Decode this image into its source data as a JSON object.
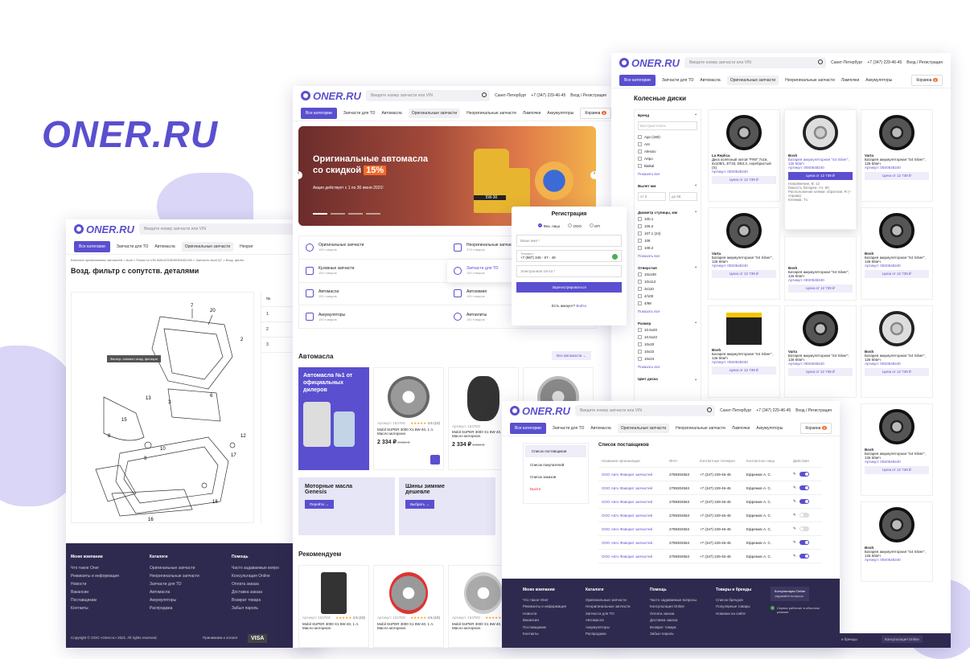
{
  "brand": "ONER.RU",
  "common": {
    "logo": "ONER.RU",
    "search_placeholder": "Введите номер запчасти или VIN",
    "city": "Санкт-Петербург",
    "phone": "+7 (347) 229-46-45",
    "login": "Вход / Регистрация",
    "all_categories": "Все категории",
    "nav": [
      "Запчасти для ТО",
      "Автомасла",
      "Оригинальные запчасти",
      "Неоригинальные запчасти",
      "Лампочки",
      "Аккумуляторы"
    ],
    "cart": "Корзина",
    "cart_count": "2"
  },
  "left_window": {
    "nav": [
      "Запчасти для ТО",
      "Автомасла",
      "Оригинальные запчасти",
      "Неориг"
    ],
    "breadcrumb": "Каталоги оригинальных запчастей  >  Audi  >  Поиск по VIN WAUZZZ4M0HD04D149  >  Запчасти Audi Q7  >  Возд. фильт",
    "title": "Возд. фильтр с сопутств. деталями",
    "tooltip": "Фильтр. элемент возд. фильтра",
    "callouts": [
      "7",
      "20",
      "2",
      "3",
      "6",
      "13",
      "15",
      "8",
      "9",
      "10",
      "12",
      "17",
      "18",
      "16"
    ],
    "table_header": "№",
    "table_rows": [
      "1",
      "2",
      "3"
    ],
    "footer": {
      "col1_title": "Меню компании",
      "col1": [
        "Что такое Oner",
        "Реквизиты и информация",
        "Новости",
        "Вакансии",
        "Поставщикам",
        "Контакты"
      ],
      "col2_title": "Каталоги",
      "col2": [
        "Оригинальные запчасти",
        "Неоригинальные запчасти",
        "Запчасти для ТО",
        "Автомасла",
        "Аккумуляторы",
        "Распродажа"
      ],
      "col3_title": "Помощь",
      "col3": [
        "Часто задаваемые вопро",
        "Консультация Online",
        "Оплата заказа",
        "Доставка заказа",
        "Возврат товара",
        "Забыл пароль"
      ],
      "copyright": "Copyright © ООО «Oner.ru» 2021. All rights reserved.",
      "payment": "Принимаем к оплате",
      "visa": "VISA"
    }
  },
  "center_window": {
    "banner_title_1": "Оригинальные автомасла",
    "banner_title_2": "со скидкой",
    "banner_discount": "15%",
    "banner_sub": "Акция действует с 1 по 30 июня 2021!",
    "oil_label": "5W-30",
    "categories": [
      {
        "name": "Оригинальные запчасти",
        "count": "150 товаров"
      },
      {
        "name": "Неоригинальные запчасти",
        "count": "376 товаров"
      },
      {
        "name": "Кузовные запчасти",
        "count": "150 товаров"
      },
      {
        "name": "Запчасти для ТО",
        "count": "150 товаров"
      },
      {
        "name": "Автомасла",
        "count": "150 товаров"
      },
      {
        "name": "Автохимия",
        "count": "150 товаров"
      },
      {
        "name": "Аккумуляторы",
        "count": "150 товаров"
      },
      {
        "name": "Автоилиты",
        "count": "150 товаров"
      }
    ],
    "section_oils": "Автомасла",
    "all_oils": "Все автомасла",
    "promo_title": "Автомасла №1 от официальных дилеров",
    "products": [
      {
        "article": "Артикул: 1537EE",
        "rating": "4.5 (10)",
        "name": "Mobil SUPER 3000 X1 5W-40, 1 л. Масло моторное.",
        "price": "2 334 ₽",
        "old": "3 856 ₽"
      },
      {
        "article": "Артикул: 1537EE",
        "rating": "",
        "name": "Mobil SUPER 3000 X1 5W-40, 1 л. Масло моторное.",
        "price": "2 334 ₽",
        "old": "3 856 ₽"
      }
    ],
    "promo2_title": "Моторные масла Genesis",
    "promo2_btn": "Перейти",
    "promo3_title": "Шины зимние дешевле",
    "promo3_btn": "Выбрать",
    "section_rec": "Рекомендуем",
    "rec": [
      {
        "article": "Артикул: 1537EE",
        "rating": "4.5 (10)",
        "name": "Mobil SUPER 3000 X1 5W-40, 1 л. Масло моторное."
      },
      {
        "article": "Артикул: 1537EE",
        "rating": "4.5 (10)",
        "name": "Mobil SUPER 3000 X1 5W-40, 1 л. Масло моторное."
      },
      {
        "article": "Артикул: 1537EE",
        "rating": "4.5 (10)",
        "name": "Mobil SUPER 3000 X1 5W-40, 1 л. Масло моторное."
      }
    ]
  },
  "register_modal": {
    "title": "Регистрация",
    "types": [
      "Физ. лицо",
      "ООО",
      "ИП"
    ],
    "name_placeholder": "Ваше имя *",
    "phone_label": "Телефон *",
    "phone_value": "+7 (987) 345 - 67 - 49",
    "email_placeholder": "Электронная почта *",
    "submit": "Зарегистрироваться",
    "have_account": "Есть аккаунт?",
    "login_link": "Войти"
  },
  "right_window": {
    "nav": [
      "Запчасти для ТО",
      "Автомасла",
      "Оригинальные запчасти",
      "Неоригинальные запчасти",
      "Лампочки",
      "Аккумуляторы"
    ],
    "title": "Колесные диски",
    "filters": {
      "brand_title": "Бренд",
      "brand_search": "Быстрый поиск",
      "brands": [
        "Ago (180)",
        "Ant",
        "Alessio",
        "Artpo",
        "Baikal"
      ],
      "show_all": "Показать все",
      "reach_title": "Вылет мм",
      "from": "от 0",
      "to": "до 68",
      "hub_title": "Диаметр ступицы, мм",
      "hubs": [
        "100.1",
        "106.2",
        "107.1 (24)",
        "108",
        "108.2"
      ],
      "holes_title": "Отверстия",
      "holes": [
        "10x108",
        "10x112",
        "3x110",
        "4/100",
        "4/98"
      ],
      "size_title": "Размер",
      "sizes": [
        "10.5x20",
        "10.5x22",
        "10x20",
        "10x22",
        "10x24"
      ],
      "color_title": "Цвет диска"
    },
    "products": [
      {
        "brand": "La Replica",
        "name": "Диск колёсный литой \"FR8\" 7x16, 5x108/1, ET33, D63.3, серебристый (S)",
        "article": "Артикул: 00S0548240",
        "price": "Цена от 12 739 ₽"
      },
      {
        "brand": "Bosh",
        "name": "Батарея аккумуляторная \"S4 Silver\", 12в 60а/ч",
        "article": "Артикул: 00S0548240",
        "price": "Цена от 12 739 ₽",
        "extra1": "Напряжение, В: 12",
        "extra2": "Емкость батареи, Ач: 60",
        "extra3": "Расположение клемм: обратная, R (+ справа)",
        "extra4": "Клемма: Т1"
      },
      {
        "brand": "Varta",
        "name": "Батарея аккумуляторная \"S4 Silver\", 12в 60а/ч",
        "article": "Артикул: 00S0548240",
        "price": "Цена от 12 739 ₽"
      },
      {
        "brand": "Varta",
        "name": "Батарея аккумуляторная \"S4 Silver\", 12в 60а/ч",
        "article": "Артикул: 00S0548240",
        "price": "Цена от 12 739 ₽"
      },
      {
        "brand": "Bosh",
        "name": "Батарея аккумуляторная \"S4 Silver\", 12в 60а/ч",
        "article": "Артикул: 00S0548240",
        "price": "Цена от 12 739 ₽"
      },
      {
        "brand": "Bosh",
        "name": "Батарея аккумуляторная \"S4 Silver\", 12в 60а/ч",
        "article": "Артикул: 00S0548240",
        "price": "Цена от 12 739 ₽"
      },
      {
        "brand": "Bosh",
        "name": "Батарея аккумуляторная \"S4 Silver\", 12в 60а/ч",
        "article": "Артикул: 00S0548240",
        "price": "Цена от 12 739 ₽"
      },
      {
        "brand": "Varta",
        "name": "Батарея аккумуляторная \"S4 Silver\", 12в 60а/ч",
        "article": "Артикул: 00S0548240",
        "price": "Цена от 12 739 ₽"
      },
      {
        "brand": "Bosh",
        "name": "Батарея аккумуляторная \"S4 Silver\", 12в 60а/ч",
        "article": "Артикул: 00S0548240",
        "price": "Цена от 12 739 ₽"
      }
    ],
    "extra_products": [
      {
        "brand": "Bosh",
        "name": "Батарея аккумуляторная \"S4 Silver\", 12в 60а/ч",
        "article": "Артикул: 00S0548240",
        "price": "Цена от 12 739 ₽"
      },
      {
        "brand": "Bosh",
        "name": "Батарея аккумуляторная \"S4 Silver\", 12в 60а/ч",
        "article": "Артикул: 00S0548240"
      }
    ],
    "footer_link": "Консультация Online",
    "footer_brands": "и бренды"
  },
  "suppliers_window": {
    "menu": [
      "Список поставщиков",
      "Список покупателей",
      "Список заказов",
      "Выйти"
    ],
    "title": "Список поставщиков",
    "columns": [
      "Название организации",
      "ИНН",
      "Контактные телефон",
      "Контактное лицо",
      "Действия"
    ],
    "rows": [
      {
        "org": "ООО Авто Фаворит запчастей",
        "inn": "2789304563",
        "phone": "+7 (347) 229-46-45",
        "person": "Ефремов А. С.",
        "on": true
      },
      {
        "org": "ООО Авто Фаворит запчастей",
        "inn": "2789304563",
        "phone": "+7 (347) 229-46-45",
        "person": "Ефремов А. С.",
        "on": true
      },
      {
        "org": "ООО Авто Фаворит запчастей",
        "inn": "2789304563",
        "phone": "+7 (347) 229-46-45",
        "person": "Ефремов А. С.",
        "on": true
      },
      {
        "org": "ООО Авто Фаворит запчастей",
        "inn": "2789304563",
        "phone": "+7 (347) 229-46-45",
        "person": "Ефремов А. С.",
        "on": false
      },
      {
        "org": "ООО Авто Фаворит запчастей",
        "inn": "2789304563",
        "phone": "+7 (347) 229-46-45",
        "person": "Ефремов А. С.",
        "on": false
      },
      {
        "org": "ООО Авто Фаворит запчастей",
        "inn": "2789304563",
        "phone": "+7 (347) 229-46-45",
        "person": "Ефремов А. С.",
        "on": true
      },
      {
        "org": "ООО Авто Фаворит запчастей",
        "inn": "2789304563",
        "phone": "+7 (347) 229-46-45",
        "person": "Ефремов А. С.",
        "on": true
      }
    ],
    "footer": {
      "col1_title": "Меню компании",
      "col1": [
        "Что такое Oner",
        "Реквизиты и информация",
        "Новости",
        "Вакансии",
        "Поставщикам",
        "Контакты"
      ],
      "col2_title": "Каталоги",
      "col2": [
        "Оригинальные запчасти",
        "Неоригинальные запчасти",
        "Запчасти для ТО",
        "Автомасла",
        "Аккумуляторы",
        "Распродажа"
      ],
      "col3_title": "Помощь",
      "col3": [
        "Часто задаваемые вопросы",
        "Консультация Online",
        "Оплата заказа",
        "Доставка заказа",
        "Возврат товара",
        "Забыл пароль"
      ],
      "col4_title": "Товары и бренды",
      "col4": [
        "Список брендов",
        "Популярные товары",
        "Новинки на сайте"
      ],
      "consult": "Консультация Online",
      "consult_sub": "задавайте вопросы",
      "service": "Сервис работает в обычном режиме"
    }
  },
  "colors": {
    "accent": "#5a4fcf",
    "orange": "#f36b2a",
    "footer": "#2e2a4f"
  }
}
